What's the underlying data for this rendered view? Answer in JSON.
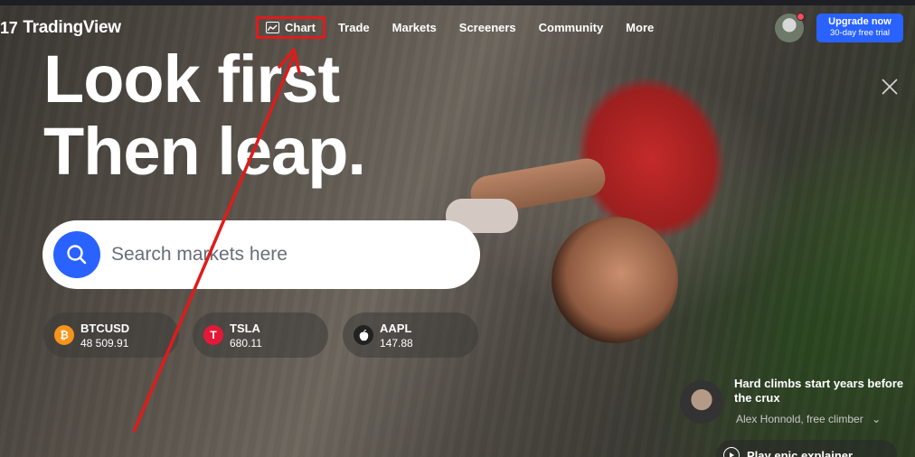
{
  "header": {
    "logo_text": "TradingView",
    "logo_mark": "17",
    "nav": [
      {
        "label": "Chart",
        "icon": "chart-line-icon"
      },
      {
        "label": "Trade"
      },
      {
        "label": "Markets"
      },
      {
        "label": "Screeners"
      },
      {
        "label": "Community"
      },
      {
        "label": "More"
      }
    ],
    "upgrade": {
      "label": "Upgrade now",
      "sub": "30-day free trial"
    }
  },
  "hero": {
    "line1": "Look first",
    "line2": "Then leap."
  },
  "search": {
    "placeholder": "Search markets here"
  },
  "tickers": [
    {
      "symbol": "BTCUSD",
      "price": "48 509.91",
      "icon": "bitcoin-icon",
      "icon_glyph": "₿",
      "color": "#f7931a"
    },
    {
      "symbol": "TSLA",
      "price": "680.11",
      "icon": "tesla-icon",
      "icon_glyph": "T",
      "color": "#e31937"
    },
    {
      "symbol": "AAPL",
      "price": "147.88",
      "icon": "apple-icon",
      "icon_glyph": "",
      "color": "#222222"
    }
  ],
  "story": {
    "title": "Hard climbs start years before the crux",
    "subtitle": "Alex Honnold, free climber",
    "play_label": "Play epic explainer"
  },
  "colors": {
    "accent": "#2962ff",
    "annotation": "#e01b1b"
  }
}
